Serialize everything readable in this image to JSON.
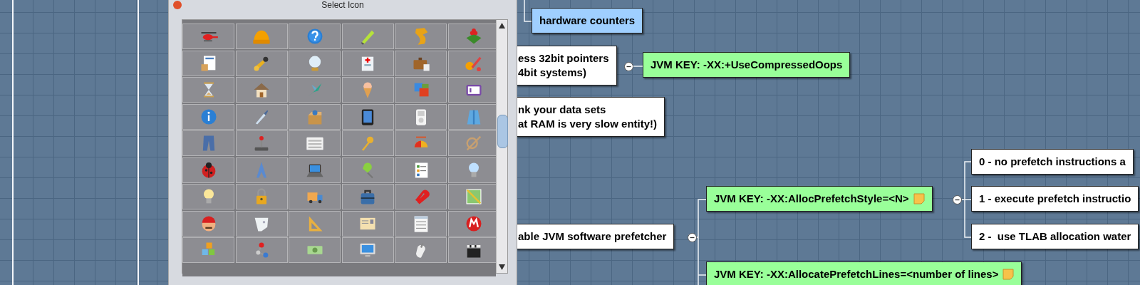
{
  "dialog": {
    "title": "Select Icon"
  },
  "nodes": [
    {
      "lines": [
        "hardware counters"
      ],
      "color": "#9fcfff",
      "has_note": false
    },
    {
      "lines": [
        "ess 32bit pointers",
        "4bit systems)"
      ],
      "color": "#ffffff",
      "has_note": false,
      "expanded": true
    },
    {
      "lines": [
        "JVM KEY: -XX:+UseCompressedOops"
      ],
      "color": "#99ff99",
      "has_note": false
    },
    {
      "lines": [
        "nk your data sets",
        "at RAM is very slow entity!)"
      ],
      "color": "#ffffff",
      "has_note": false
    },
    {
      "lines": [
        "able JVM software prefetcher"
      ],
      "color": "#ffffff",
      "has_note": false,
      "expanded": true
    },
    {
      "lines": [
        "JVM KEY: -XX:AllocPrefetchStyle=<N>"
      ],
      "color": "#99ff99",
      "has_note": true,
      "expanded": true
    },
    {
      "lines": [
        "0 - no prefetch instructions a"
      ],
      "color": "#ffffff",
      "has_note": false
    },
    {
      "lines": [
        "1 - execute prefetch instructio"
      ],
      "color": "#ffffff",
      "has_note": false
    },
    {
      "lines": [
        "2 -  use TLAB allocation water"
      ],
      "color": "#ffffff",
      "has_note": false
    },
    {
      "lines": [
        "JVM KEY: -XX:AllocatePrefetchLines=<number of lines>"
      ],
      "color": "#99ff99",
      "has_note": true
    }
  ]
}
